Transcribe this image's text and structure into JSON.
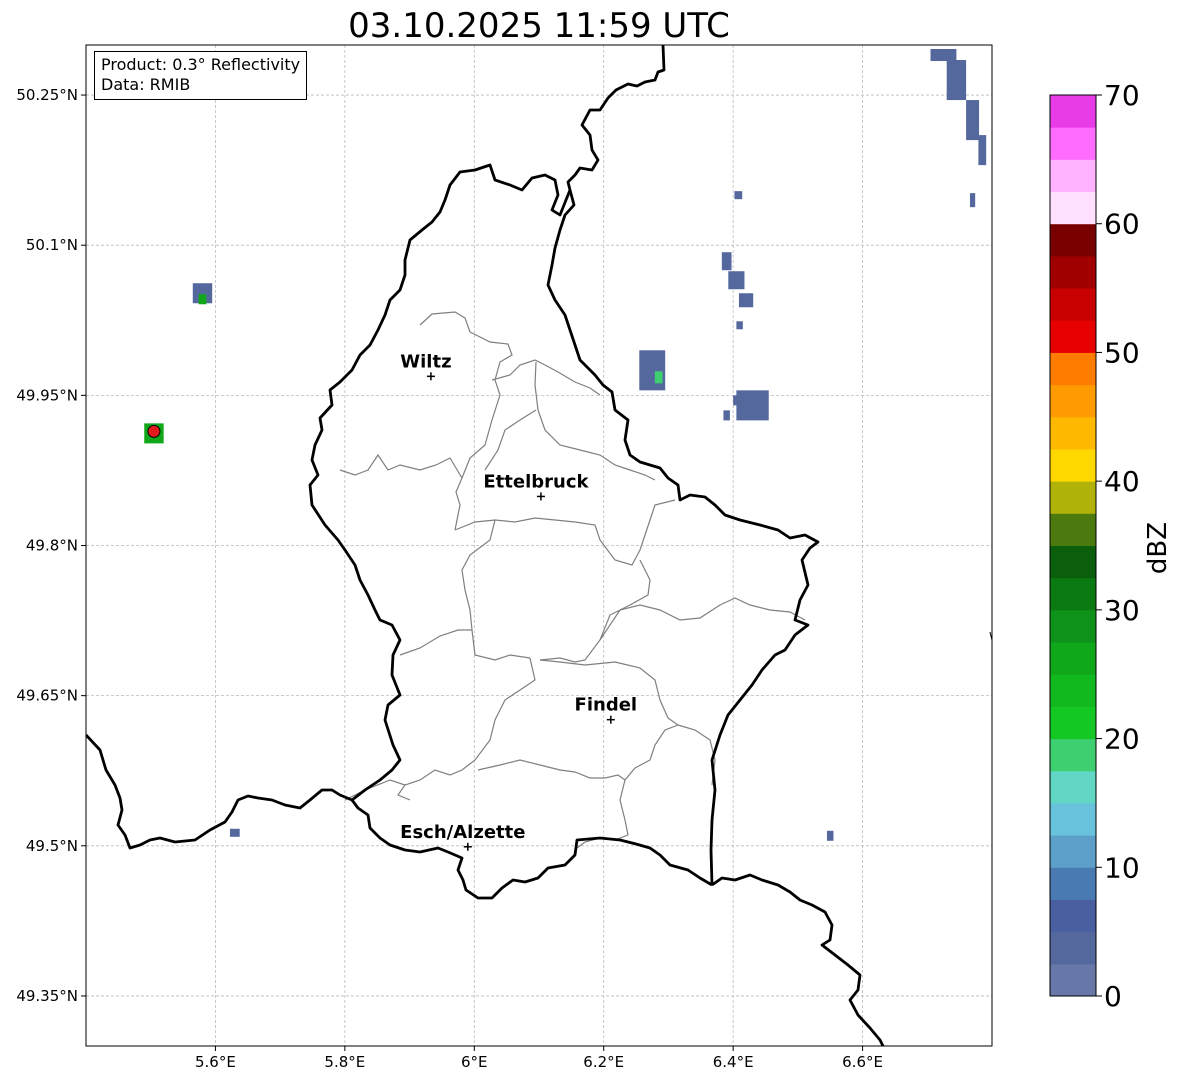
{
  "title": "03.10.2025 11:59 UTC",
  "info": {
    "product": "Product: 0.3° Reflectivity",
    "data_source": "Data: RMIB"
  },
  "axes": {
    "x_ticks": [
      "5.6°E",
      "5.8°E",
      "6°E",
      "6.2°E",
      "6.4°E",
      "6.6°E"
    ],
    "x_values": [
      5.6,
      5.8,
      6.0,
      6.2,
      6.4,
      6.6
    ],
    "y_ticks": [
      "50.25°N",
      "50.1°N",
      "49.95°N",
      "49.8°N",
      "49.65°N",
      "49.5°N",
      "49.35°N"
    ],
    "y_values": [
      50.25,
      50.1,
      49.95,
      49.8,
      49.65,
      49.5,
      49.35
    ],
    "lon_range": [
      5.4,
      6.8
    ],
    "lat_range": [
      49.3,
      50.3
    ],
    "grid": true
  },
  "cities": [
    {
      "name": "Wiltz",
      "lon": 5.933,
      "lat": 49.969
    },
    {
      "name": "Ettelbruck",
      "lon": 6.103,
      "lat": 49.849
    },
    {
      "name": "Findel",
      "lon": 6.211,
      "lat": 49.626
    },
    {
      "name": "Esch/Alzette",
      "lon": 5.99,
      "lat": 49.499
    }
  ],
  "radar_site": {
    "lon": 5.505,
    "lat": 49.914,
    "color": "#e41a1c"
  },
  "colorbar": {
    "label": "dBZ",
    "ticks": [
      "0",
      "10",
      "20",
      "30",
      "40",
      "50",
      "60",
      "70"
    ],
    "tick_values": [
      0,
      10,
      20,
      30,
      40,
      50,
      60,
      70
    ],
    "colors": [
      "#6677a8",
      "#55689e",
      "#4a5fa0",
      "#4a7ab2",
      "#5c9fc9",
      "#68c2dc",
      "#61d6c4",
      "#3ecf70",
      "#14c824",
      "#12b91e",
      "#10a81a",
      "#0f921a",
      "#0c7a12",
      "#0a5e0c",
      "#4d7a0f",
      "#b0b20a",
      "#ffd800",
      "#ffb800",
      "#ff9a00",
      "#ff7c00",
      "#e60000",
      "#c80000",
      "#a00000",
      "#780000",
      "#ffe0ff",
      "#ffb2ff",
      "#ff6cff",
      "#e83ce8"
    ]
  },
  "chart_data": {
    "type": "map",
    "title": "03.10.2025 11:59 UTC",
    "xlim": [
      5.4,
      6.8
    ],
    "ylim": [
      49.3,
      50.3
    ],
    "colorbar_range": [
      0,
      70
    ],
    "colorbar_label": "dBZ",
    "echoes": [
      {
        "lon": 6.725,
        "lat": 50.29,
        "w": 0.04,
        "h": 0.012,
        "dbz": 4
      },
      {
        "lon": 6.745,
        "lat": 50.265,
        "w": 0.03,
        "h": 0.04,
        "dbz": 4
      },
      {
        "lon": 6.77,
        "lat": 50.225,
        "w": 0.02,
        "h": 0.04,
        "dbz": 3
      },
      {
        "lon": 6.785,
        "lat": 50.195,
        "w": 0.012,
        "h": 0.03,
        "dbz": 3
      },
      {
        "lon": 6.77,
        "lat": 50.145,
        "w": 0.008,
        "h": 0.014,
        "dbz": 3
      },
      {
        "lon": 6.39,
        "lat": 50.084,
        "w": 0.015,
        "h": 0.018,
        "dbz": 4
      },
      {
        "lon": 6.405,
        "lat": 50.065,
        "w": 0.025,
        "h": 0.018,
        "dbz": 4
      },
      {
        "lon": 6.42,
        "lat": 50.045,
        "w": 0.022,
        "h": 0.014,
        "dbz": 4
      },
      {
        "lon": 6.41,
        "lat": 50.02,
        "w": 0.01,
        "h": 0.008,
        "dbz": 3
      },
      {
        "lon": 6.408,
        "lat": 50.15,
        "w": 0.012,
        "h": 0.008,
        "dbz": 3
      },
      {
        "lon": 6.275,
        "lat": 49.975,
        "w": 0.04,
        "h": 0.04,
        "dbz": 4
      },
      {
        "lon": 6.285,
        "lat": 49.968,
        "w": 0.012,
        "h": 0.012,
        "dbz": 18
      },
      {
        "lon": 6.43,
        "lat": 49.94,
        "w": 0.05,
        "h": 0.03,
        "dbz": 4
      },
      {
        "lon": 6.39,
        "lat": 49.93,
        "w": 0.01,
        "h": 0.01,
        "dbz": 3
      },
      {
        "lon": 6.405,
        "lat": 49.945,
        "w": 0.01,
        "h": 0.01,
        "dbz": 3
      },
      {
        "lon": 5.58,
        "lat": 50.052,
        "w": 0.03,
        "h": 0.02,
        "dbz": 4
      },
      {
        "lon": 5.58,
        "lat": 50.046,
        "w": 0.012,
        "h": 0.01,
        "dbz": 26
      },
      {
        "lon": 5.505,
        "lat": 49.912,
        "w": 0.03,
        "h": 0.02,
        "dbz": 26
      },
      {
        "lon": 5.63,
        "lat": 49.513,
        "w": 0.015,
        "h": 0.008,
        "dbz": 3
      },
      {
        "lon": 6.55,
        "lat": 49.51,
        "w": 0.01,
        "h": 0.01,
        "dbz": 3
      }
    ]
  }
}
